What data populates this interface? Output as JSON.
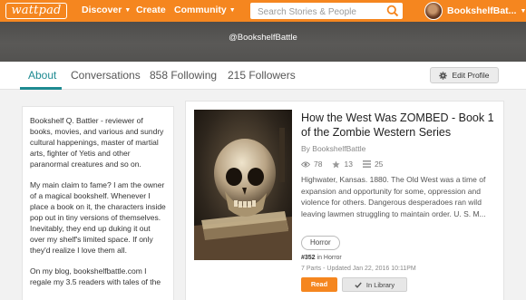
{
  "nav": {
    "logo": "wattpad",
    "discover": "Discover",
    "create": "Create",
    "community": "Community",
    "search_placeholder": "Search Stories & People",
    "username": "BookshelfBat..."
  },
  "profile": {
    "handle": "@BookshelfBattle"
  },
  "tabs": {
    "about": "About",
    "conversations": "Conversations",
    "following": "858 Following",
    "followers": "215 Followers",
    "edit_profile": "Edit Profile"
  },
  "about": {
    "paragraphs": [
      "Bookshelf Q. Battler - reviewer of books, movies, and various and sundry cultural happenings, master of martial arts, fighter of Yetis and other paranormal creatures and so on.",
      "My main claim to fame?  I am the owner of a magical bookshelf. Whenever I place a book on it, the characters inside pop out in tiny versions of themselves.  Inevitably, they end up duking it out over my shelf's limited space.  If only they'd realize I love them all.",
      "On my blog, bookshelfbattle.com I regale my 3.5 readers with tales of the"
    ]
  },
  "story": {
    "title": "How the West Was ZOMBED - Book 1 of the Zombie Western Series",
    "author": "By BookshelfBattle",
    "reads": "78",
    "votes": "13",
    "parts_count": "25",
    "description": "Highwater, Kansas. 1880. The Old West was a time of expansion and opportunity for some, oppression and violence for others. Dangerous desperadoes ran wild leaving lawmen struggling to maintain order. U. S. M...",
    "tag": "Horror",
    "rank": "#352",
    "rank_category": "in Horror",
    "meta": "7 Parts - Updated Jan 22, 2016 10:11PM",
    "read_label": "Read",
    "library_label": "In Library"
  },
  "colors": {
    "brand": "#f5861f",
    "accent": "#1e8a91",
    "banner": "#555452"
  }
}
